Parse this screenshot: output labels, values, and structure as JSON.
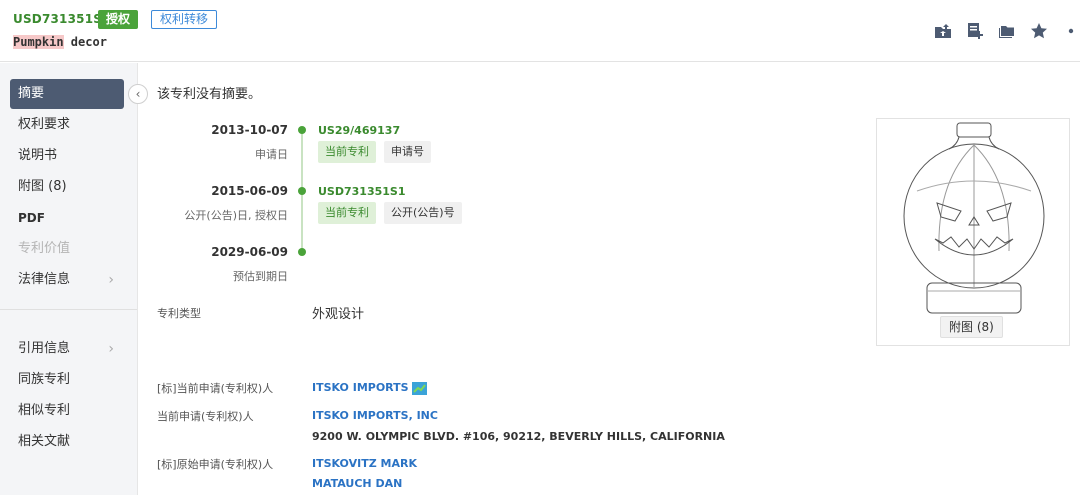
{
  "header": {
    "patent_number": "USD731351S1",
    "status_badge": "授权",
    "transfer_badge": "权利转移",
    "title_highlight": "Pumpkin",
    "title_rest": " decor",
    "toolbar_icons": [
      "folder-upload-icon",
      "add-note-icon",
      "folders-icon",
      "star-icon",
      "more-icon"
    ]
  },
  "sidebar": {
    "items": [
      {
        "label": "摘要",
        "active": true
      },
      {
        "label": "权利要求"
      },
      {
        "label": "说明书"
      },
      {
        "label": "附图 (8)"
      },
      {
        "label": "PDF"
      },
      {
        "label": "专利价值",
        "disabled": true
      },
      {
        "label": "法律信息",
        "chevron": "›"
      },
      {
        "label": "引用信息",
        "chevron": "›"
      },
      {
        "label": "同族专利"
      },
      {
        "label": "相似专利"
      },
      {
        "label": "相关文献"
      }
    ],
    "collapse_glyph": "‹"
  },
  "abstract": {
    "text": "该专利没有摘要。"
  },
  "timeline": [
    {
      "date": "2013-10-07",
      "label": "申请日",
      "number": "US29/469137",
      "tags": [
        "当前专利",
        "申请号"
      ]
    },
    {
      "date": "2015-06-09",
      "label": "公开(公告)日, 授权日",
      "number": "USD731351S1",
      "tags": [
        "当前专利",
        "公开(公告)号"
      ]
    },
    {
      "date": "2029-06-09",
      "label": "预估到期日",
      "number": "",
      "tags": []
    }
  ],
  "patent_type": {
    "label": "专利类型",
    "value": "外观设计"
  },
  "applicants": {
    "std_label": "[标]当前申请(专利权)人",
    "std_value": "ITSKO IMPORTS",
    "current_label": "当前申请(专利权)人",
    "current_value": "ITSKO IMPORTS, INC",
    "current_address": "9200 W. OLYMPIC BLVD. #106, 90212, BEVERLY HILLS, CALIFORNIA",
    "original_label": "[标]原始申请(专利权)人",
    "original_values": [
      "ITSKOVITZ MARK",
      "MATAUCH DAN"
    ]
  },
  "figure": {
    "button_label": "附图 (8)"
  },
  "colors": {
    "green": "#4aa33a",
    "blue": "#2b73c4",
    "nav_active": "#4d5b72"
  }
}
